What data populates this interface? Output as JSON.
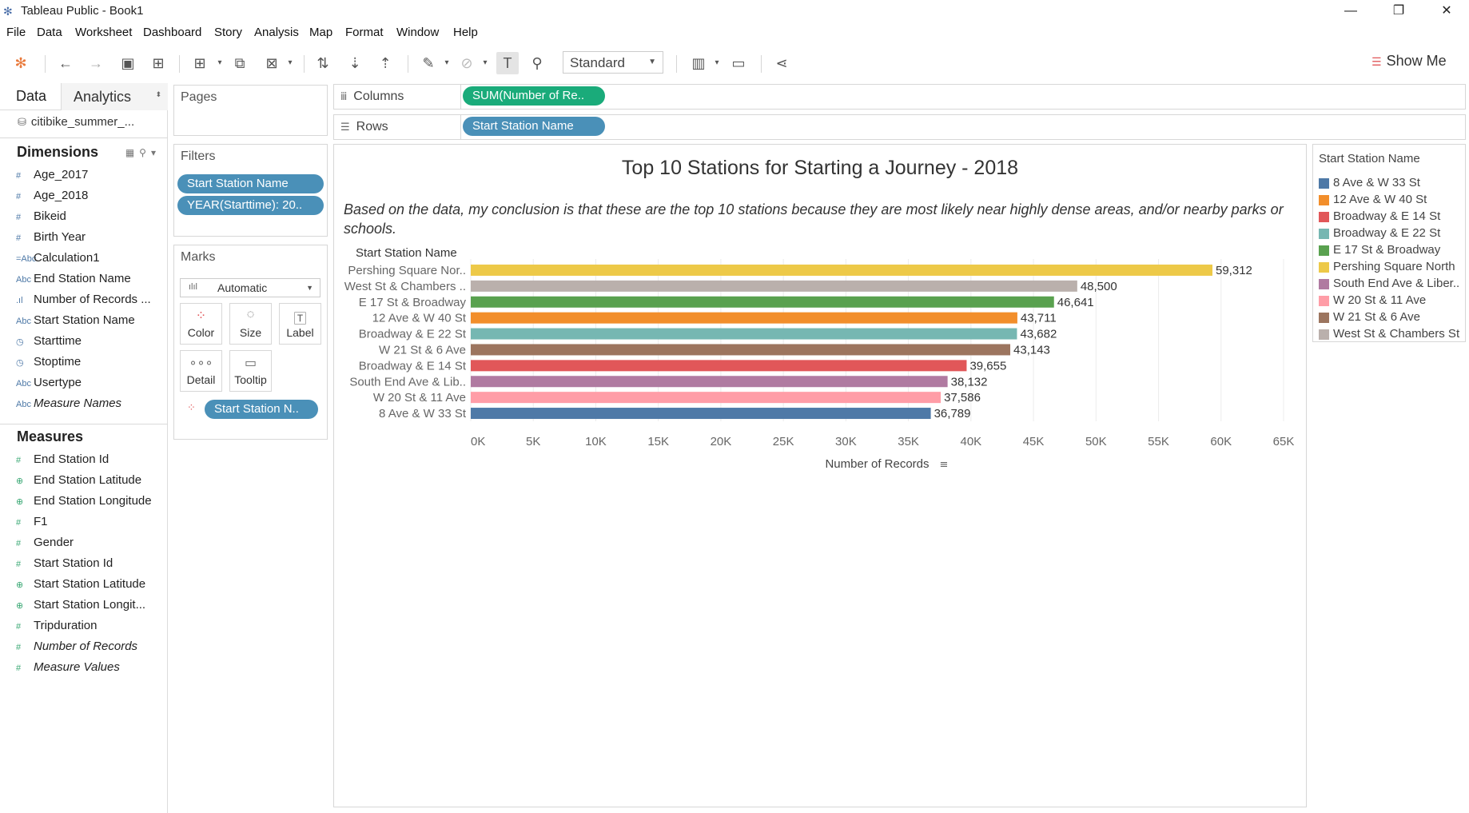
{
  "window": {
    "title": "Tableau Public - Book1"
  },
  "menu": [
    "File",
    "Data",
    "Worksheet",
    "Dashboard",
    "Story",
    "Analysis",
    "Map",
    "Format",
    "Window",
    "Help"
  ],
  "toolbar": {
    "fit": "Standard",
    "show_me": "Show Me"
  },
  "left": {
    "tab_data": "Data",
    "tab_analytics": "Analytics",
    "datasource": "citibike_summer_...",
    "dimensions_title": "Dimensions",
    "dimensions": [
      {
        "icon": "#",
        "label": "Age_2017",
        "italic": false
      },
      {
        "icon": "#",
        "label": "Age_2018",
        "italic": false
      },
      {
        "icon": "#",
        "label": "Bikeid",
        "italic": false
      },
      {
        "icon": "#",
        "label": "Birth Year",
        "italic": false
      },
      {
        "icon": "=Abc",
        "label": "Calculation1",
        "italic": false
      },
      {
        "icon": "Abc",
        "label": "End Station Name",
        "italic": false
      },
      {
        "icon": ".ıl",
        "label": "Number of Records ...",
        "italic": false
      },
      {
        "icon": "Abc",
        "label": "Start Station Name",
        "italic": false
      },
      {
        "icon": "◷",
        "label": "Starttime",
        "italic": false
      },
      {
        "icon": "◷",
        "label": "Stoptime",
        "italic": false
      },
      {
        "icon": "Abc",
        "label": "Usertype",
        "italic": false
      },
      {
        "icon": "Abc",
        "label": "Measure Names",
        "italic": true
      }
    ],
    "measures_title": "Measures",
    "measures": [
      {
        "icon": "#",
        "label": "End Station Id",
        "italic": false
      },
      {
        "icon": "⊕",
        "label": "End Station Latitude",
        "italic": false
      },
      {
        "icon": "⊕",
        "label": "End Station Longitude",
        "italic": false
      },
      {
        "icon": "#",
        "label": "F1",
        "italic": false
      },
      {
        "icon": "#",
        "label": "Gender",
        "italic": false
      },
      {
        "icon": "#",
        "label": "Start Station Id",
        "italic": false
      },
      {
        "icon": "⊕",
        "label": "Start Station Latitude",
        "italic": false
      },
      {
        "icon": "⊕",
        "label": "Start Station Longit...",
        "italic": false
      },
      {
        "icon": "#",
        "label": "Tripduration",
        "italic": false
      },
      {
        "icon": "#",
        "label": "Number of Records",
        "italic": true
      },
      {
        "icon": "#",
        "label": "Measure Values",
        "italic": true
      }
    ]
  },
  "pages": {
    "title": "Pages"
  },
  "filters": {
    "title": "Filters",
    "items": [
      "Start Station Name",
      "YEAR(Starttime): 20.."
    ]
  },
  "marks": {
    "title": "Marks",
    "type": "Automatic",
    "buttons": [
      "Color",
      "Size",
      "Label",
      "Detail",
      "Tooltip"
    ],
    "color_pill": "Start Station N.."
  },
  "shelves": {
    "columns_label": "Columns",
    "columns_pill": "SUM(Number of Re..",
    "rows_label": "Rows",
    "rows_pill": "Start Station Name"
  },
  "chart_data": {
    "type": "bar",
    "title": "Top 10 Stations for Starting a Journey - 2018",
    "caption": "Based on the data, my conclusion is that these are the top 10 stations because they are most likely near highly dense areas, and/or nearby parks or schools.",
    "row_header": "Start Station Name",
    "xlabel": "Number of Records",
    "xlim": [
      0,
      65000
    ],
    "xticks": [
      0,
      5000,
      10000,
      15000,
      20000,
      25000,
      30000,
      35000,
      40000,
      45000,
      50000,
      55000,
      60000,
      65000
    ],
    "xtick_labels": [
      "0K",
      "5K",
      "10K",
      "15K",
      "20K",
      "25K",
      "30K",
      "35K",
      "40K",
      "45K",
      "50K",
      "55K",
      "60K",
      "65K"
    ],
    "categories": [
      "Pershing Square Nor..",
      "West St & Chambers ..",
      "E 17 St & Broadway",
      "12 Ave & W 40 St",
      "Broadway & E 22 St",
      "W 21 St & 6 Ave",
      "Broadway & E 14 St",
      "South End Ave & Lib..",
      "W 20 St & 11 Ave",
      "8 Ave & W 33 St"
    ],
    "values": [
      59312,
      48500,
      46641,
      43711,
      43682,
      43143,
      39655,
      38132,
      37586,
      36789
    ],
    "value_labels": [
      "59,312",
      "48,500",
      "46,641",
      "43,711",
      "43,682",
      "43,143",
      "39,655",
      "38,132",
      "37,586",
      "36,789"
    ],
    "colors": [
      "#edc948",
      "#bab0ac",
      "#59a14f",
      "#f28e2b",
      "#76b7b2",
      "#9c755f",
      "#e15759",
      "#b07aa1",
      "#ff9da7",
      "#4e79a7"
    ],
    "grid": true
  },
  "legend": {
    "title": "Start Station Name",
    "items": [
      {
        "label": "8 Ave & W 33 St",
        "color": "#4e79a7"
      },
      {
        "label": "12 Ave & W 40 St",
        "color": "#f28e2b"
      },
      {
        "label": "Broadway & E 14 St",
        "color": "#e15759"
      },
      {
        "label": "Broadway & E 22 St",
        "color": "#76b7b2"
      },
      {
        "label": "E 17 St & Broadway",
        "color": "#59a14f"
      },
      {
        "label": "Pershing Square North",
        "color": "#edc948"
      },
      {
        "label": "South End Ave & Liber..",
        "color": "#b07aa1"
      },
      {
        "label": "W 20 St & 11 Ave",
        "color": "#ff9da7"
      },
      {
        "label": "W 21 St & 6 Ave",
        "color": "#9c755f"
      },
      {
        "label": "West St & Chambers St",
        "color": "#bab0ac"
      }
    ]
  }
}
